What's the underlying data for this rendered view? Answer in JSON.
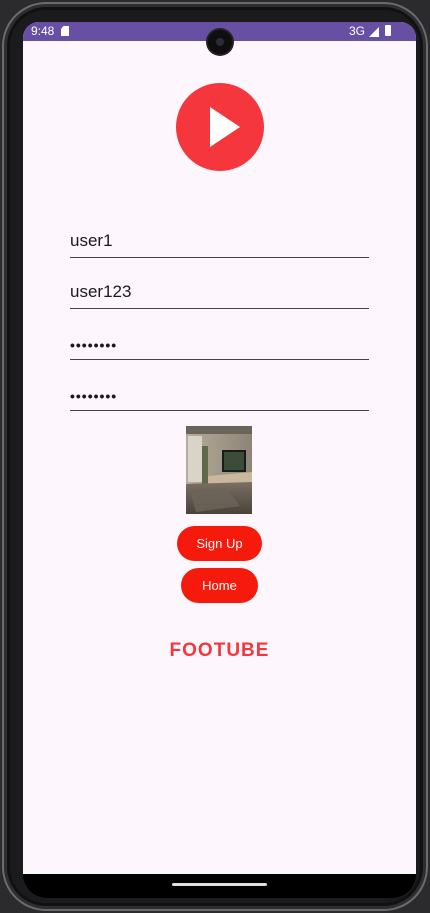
{
  "status_bar": {
    "time": "9:48",
    "network": "3G",
    "color": "#6750a4"
  },
  "app": {
    "logo_icon": "play-icon",
    "brand_color": "#f5363d",
    "brand_text": "FOOTUBE"
  },
  "form": {
    "username_value": "user1",
    "name_value": "user123",
    "password_value": "••••••••",
    "confirm_password_value": "••••••••"
  },
  "buttons": {
    "signup_label": "Sign Up",
    "home_label": "Home",
    "color": "#f51a0c"
  }
}
